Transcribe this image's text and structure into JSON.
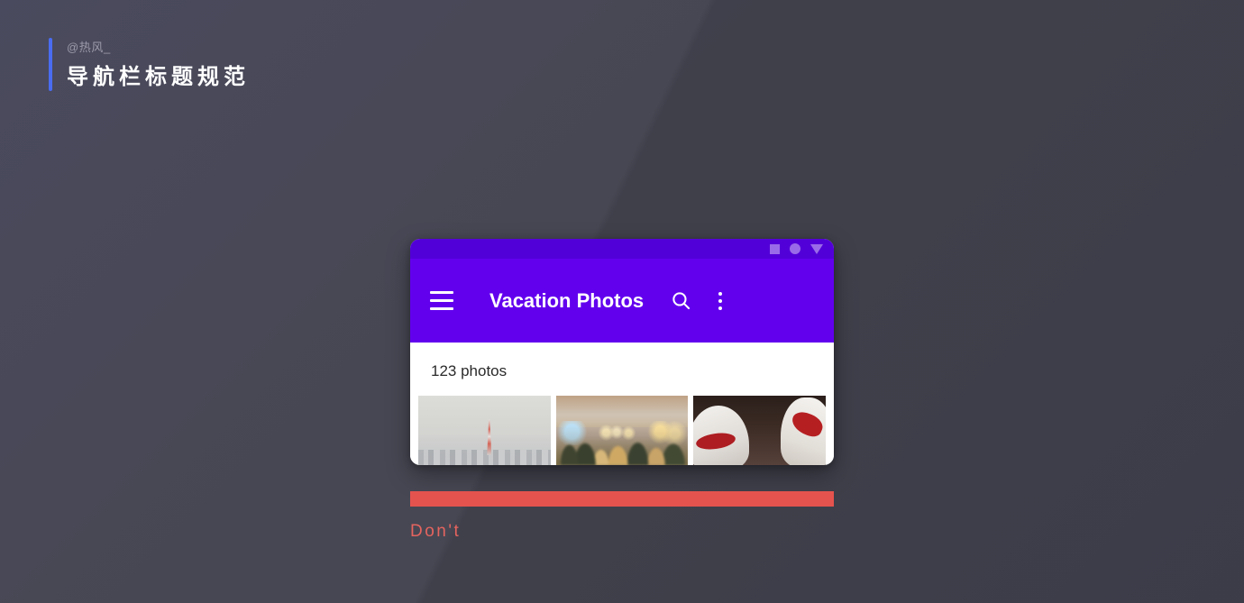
{
  "background": {
    "base_color": "#43434f",
    "accent_color": "#4a6cf0"
  },
  "header": {
    "handle": "@热风_",
    "title": "导航栏标题规范"
  },
  "phone": {
    "status_bar": {
      "icons": [
        "square-icon",
        "circle-icon",
        "triangle-down-icon"
      ],
      "color": "#5200d8"
    },
    "app_bar": {
      "color": "#6200ee",
      "menu_icon": "hamburger-menu-icon",
      "title": "Vacation Photos",
      "actions": [
        {
          "icon": "search-icon",
          "label": "Search"
        },
        {
          "icon": "overflow-menu-icon",
          "label": "More options"
        }
      ]
    },
    "content": {
      "photo_count": "123 photos",
      "thumbnails": [
        {
          "name": "tokyo-tower-skyline"
        },
        {
          "name": "crowd-with-lights"
        },
        {
          "name": "white-shapes-red-accent"
        }
      ]
    }
  },
  "annotation": {
    "bar_color": "#e5534e",
    "label": "Don't",
    "label_color": "#e5645f"
  }
}
